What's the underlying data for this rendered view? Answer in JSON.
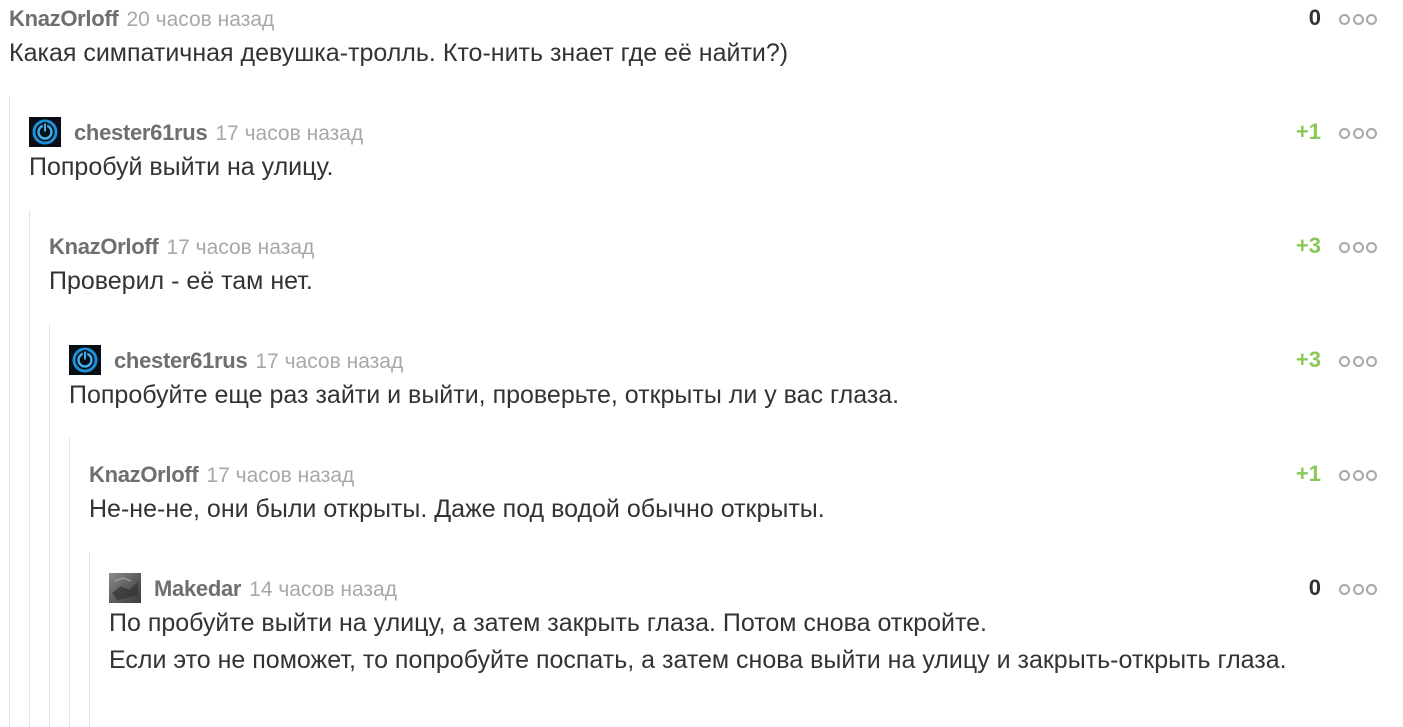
{
  "comments": [
    {
      "author": "KnazOrloff",
      "time": "20 часов назад",
      "rating": "0",
      "text": "Какая симпатичная девушка-тролль. Кто-нить знает где её найти?)"
    },
    {
      "author": "chester61rus",
      "time": "17 часов назад",
      "rating": "+1",
      "text": "Попробуй выйти на улицу."
    },
    {
      "author": "KnazOrloff",
      "time": "17 часов назад",
      "rating": "+3",
      "text": "Проверил - её там нет."
    },
    {
      "author": "chester61rus",
      "time": "17 часов назад",
      "rating": "+3",
      "text": "Попробуйте еще раз зайти и выйти, проверьте, открыты ли у вас глаза."
    },
    {
      "author": "KnazOrloff",
      "time": "17 часов назад",
      "rating": "+1",
      "text": "Не-не-не, они были открыты. Даже под водой обычно открыты."
    },
    {
      "author": "Makedar",
      "time": "14 часов назад",
      "rating": "0",
      "text": "По пробуйте выйти на улицу, а затем закрыть глаза. Потом снова откройте.\nЕсли это не поможет, то попробуйте поспать, а затем снова выйти на улицу и закрыть-открыть глаза."
    }
  ],
  "colors": {
    "rating_positive": "#8ac858",
    "rating_neutral": "#333333",
    "author": "#6f6f6f",
    "time": "#a8a8a8"
  },
  "icons": [
    "power-avatar-icon",
    "gray-avatar-icon",
    "more-dots-icon"
  ]
}
